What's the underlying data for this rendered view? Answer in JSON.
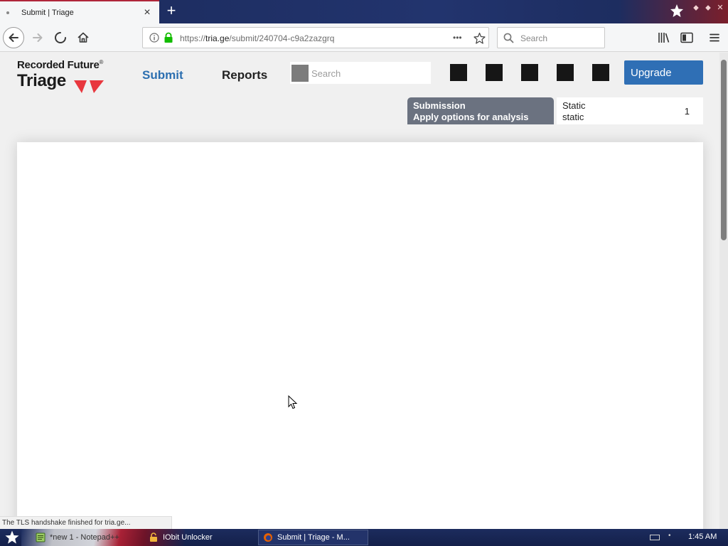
{
  "browser": {
    "tab_title": "Submit | Triage",
    "tab_close": "×",
    "new_tab": "+",
    "url_prefix": "https://",
    "url_host": "tria.ge",
    "url_path": "/submit/240704-c9a2zazgrq",
    "url_more": "•••",
    "search_placeholder": "Search"
  },
  "page": {
    "logo_top": "Recorded Future",
    "logo_registered": "®",
    "logo_bottom": "Triage",
    "nav_submit": "Submit",
    "nav_reports": "Reports",
    "search_placeholder": "Search",
    "upgrade_label": "Upgrade",
    "submission_title": "Submission",
    "submission_subtitle": "Apply options for analysis",
    "static_title": "Static",
    "static_subtitle": "static",
    "static_count": "1"
  },
  "status": {
    "message": "The TLS handshake finished for tria.ge..."
  },
  "taskbar": {
    "item1": "*new 1 - Notepad++",
    "item2": "IObit Unlocker",
    "item3": "Submit | Triage - M...",
    "clock": "1:45 AM"
  },
  "colors": {
    "accent": "#2f6fb5",
    "nav_active": "#2c6fb0",
    "logo_red": "#e8373e",
    "submission_bg": "#6b7280"
  }
}
